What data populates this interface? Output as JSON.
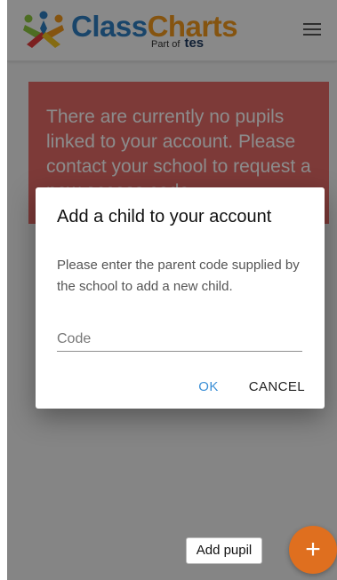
{
  "brand": {
    "name_part1": "Class",
    "name_part2": "Charts",
    "sub_prefix": "Part of",
    "sub_brand": "tes",
    "color_blue": "#2f7ec1",
    "color_orange": "#f39a1e"
  },
  "header": {
    "menu_icon": "hamburger-menu-icon"
  },
  "notice": {
    "text": "There are currently no pupils linked to your account. Please contact your school to request a new access code.",
    "color": "#e36b67"
  },
  "dialog": {
    "title": "Add a child to your account",
    "message": "Please enter the parent code supplied by the school to add a new child.",
    "code_placeholder": "Code",
    "code_value": "",
    "ok_label": "OK",
    "cancel_label": "CANCEL",
    "ok_color": "#3b8fd6"
  },
  "footer": {
    "add_pupil_label": "Add pupil",
    "fab_icon": "plus-icon",
    "fab_symbol": "+",
    "fab_color": "#df6f1f"
  }
}
